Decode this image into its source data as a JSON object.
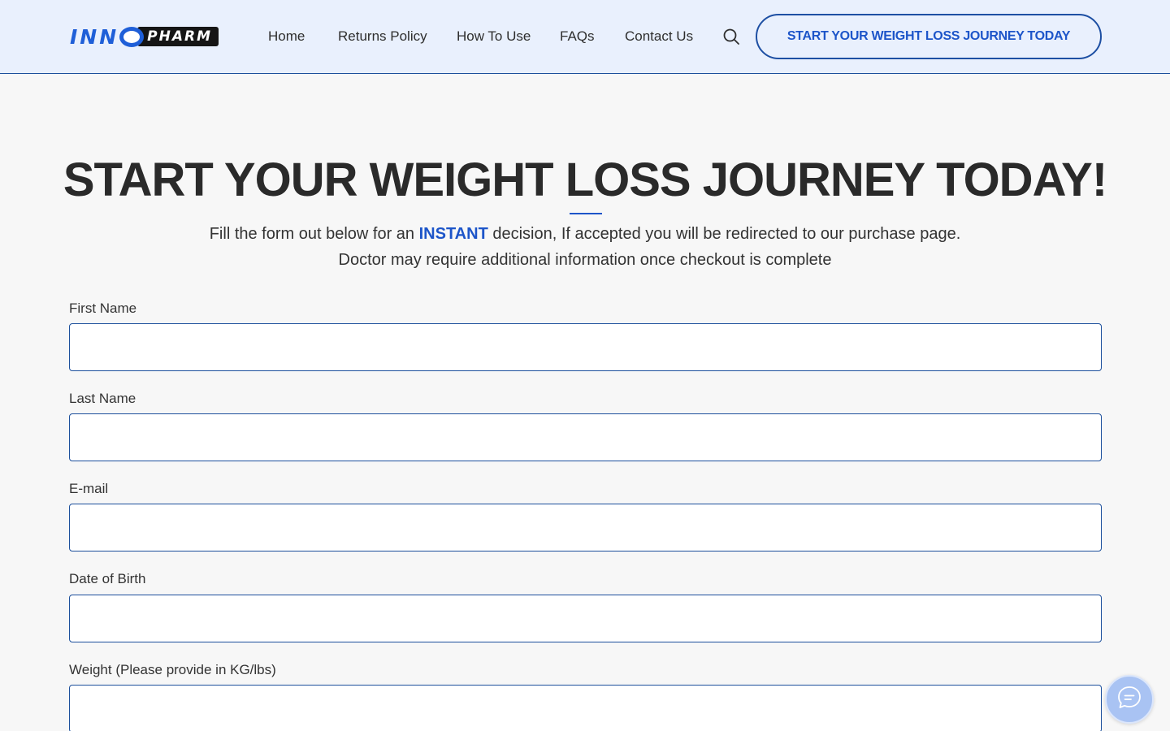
{
  "brand": {
    "logo_part1": "INN",
    "logo_part2": "PHARM",
    "accent_color": "#1d55c9",
    "border_color": "#1c4f9c"
  },
  "nav": {
    "items": [
      {
        "label": "Home"
      },
      {
        "label": "Returns Policy"
      },
      {
        "label": "How To Use"
      },
      {
        "label": "FAQs"
      },
      {
        "label": "Contact Us"
      }
    ],
    "search_icon": "search-icon",
    "cta_label": "START YOUR WEIGHT LOSS JOURNEY TODAY"
  },
  "hero": {
    "title": "START YOUR WEIGHT LOSS JOURNEY TODAY!",
    "subtitle_before": "Fill the form out below for an ",
    "subtitle_highlight": "INSTANT",
    "subtitle_after": " decision, If accepted you will be redirected to our purchase page.",
    "subtitle_line2": "Doctor may require additional information once checkout is complete"
  },
  "form": {
    "fields": [
      {
        "label": "First Name",
        "value": ""
      },
      {
        "label": "Last Name",
        "value": ""
      },
      {
        "label": "E-mail",
        "value": ""
      },
      {
        "label": "Date of Birth",
        "value": ""
      },
      {
        "label": "Weight (Please provide in KG/lbs)",
        "value": ""
      }
    ]
  },
  "chat": {
    "icon": "chat-bubble-icon"
  }
}
